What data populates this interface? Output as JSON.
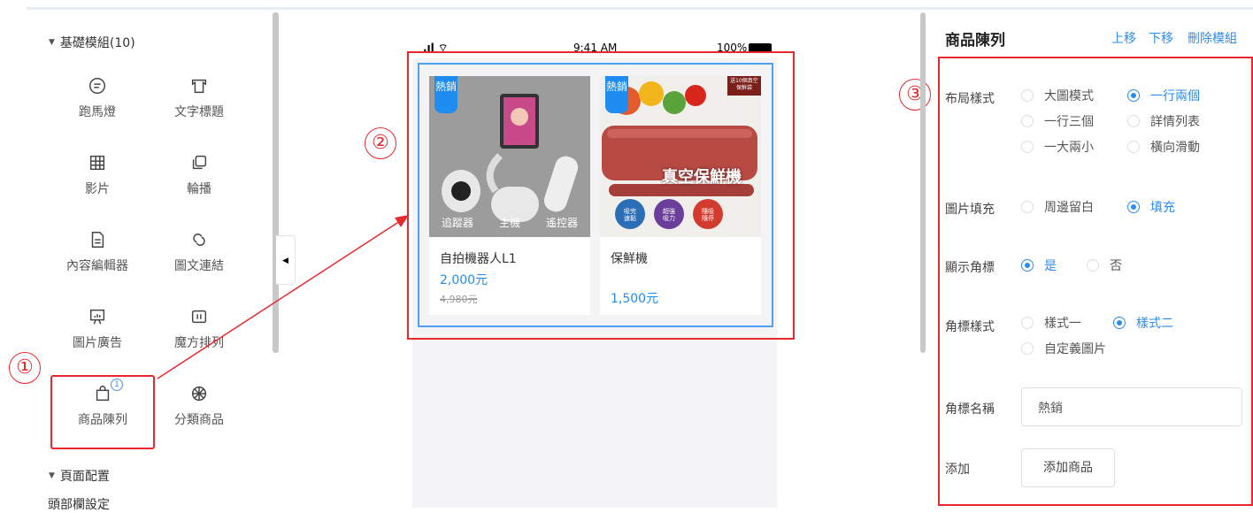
{
  "left_panel": {
    "basic_section": "基礎模組(10)",
    "components": [
      {
        "label": "跑馬燈",
        "icon": "chat-bubble-icon"
      },
      {
        "label": "文字標題",
        "icon": "text-title-icon"
      },
      {
        "label": "影片",
        "icon": "grid-icon"
      },
      {
        "label": "輪播",
        "icon": "layers-icon"
      },
      {
        "label": "內容編輯器",
        "icon": "document-icon"
      },
      {
        "label": "圖文連結",
        "icon": "link-icon"
      },
      {
        "label": "圖片廣告",
        "icon": "ad-board-icon"
      },
      {
        "label": "魔方排列",
        "icon": "cube-layout-icon"
      },
      {
        "label": "商品陳列",
        "icon": "shopping-bag-icon",
        "badge": "1"
      },
      {
        "label": "分類商品",
        "icon": "category-wheel-icon"
      }
    ],
    "page_section": "頁面配置",
    "page_sub": "頭部欄設定"
  },
  "callouts": [
    "①",
    "②",
    "③"
  ],
  "phone": {
    "time": "9:41 AM",
    "battery": "100%",
    "products": [
      {
        "tag": "熱銷",
        "name": "自拍機器人L1",
        "price": "2,000元",
        "old_price": "4,980元",
        "captions": [
          "追蹤器",
          "主機",
          "遙控器"
        ]
      },
      {
        "tag": "熱銷",
        "name": "保鮮機",
        "price": "1,500元",
        "image_text": "真空保鮮機",
        "corner_text": "送10個真空保鮮袋",
        "pills": [
          "吸完速黏",
          "超強吸力",
          "隨吸隨停"
        ]
      }
    ]
  },
  "settings": {
    "title": "商品陳列",
    "actions": [
      "上移",
      "下移",
      "刪除模組"
    ],
    "layout_label": "布局樣式",
    "layout_options": [
      "大圖模式",
      "一行兩個",
      "一行三個",
      "詳情列表",
      "一大兩小",
      "橫向滑動"
    ],
    "layout_selected": "一行兩個",
    "fill_label": "圖片填充",
    "fill_options": [
      "周邊留白",
      "填充"
    ],
    "fill_selected": "填充",
    "corner_label": "顯示角標",
    "corner_options": [
      "是",
      "否"
    ],
    "corner_selected": "是",
    "corner_style_label": "角標樣式",
    "corner_style_options": [
      "樣式一",
      "樣式二",
      "自定義圖片"
    ],
    "corner_style_selected": "樣式二",
    "corner_name_label": "角標名稱",
    "corner_name_value": "熱銷",
    "add_label": "添加",
    "add_button": "添加商品"
  },
  "colors": {
    "accent": "#2d8cf0",
    "annotation": "#e8282d",
    "tag": "#1e8cf0"
  }
}
